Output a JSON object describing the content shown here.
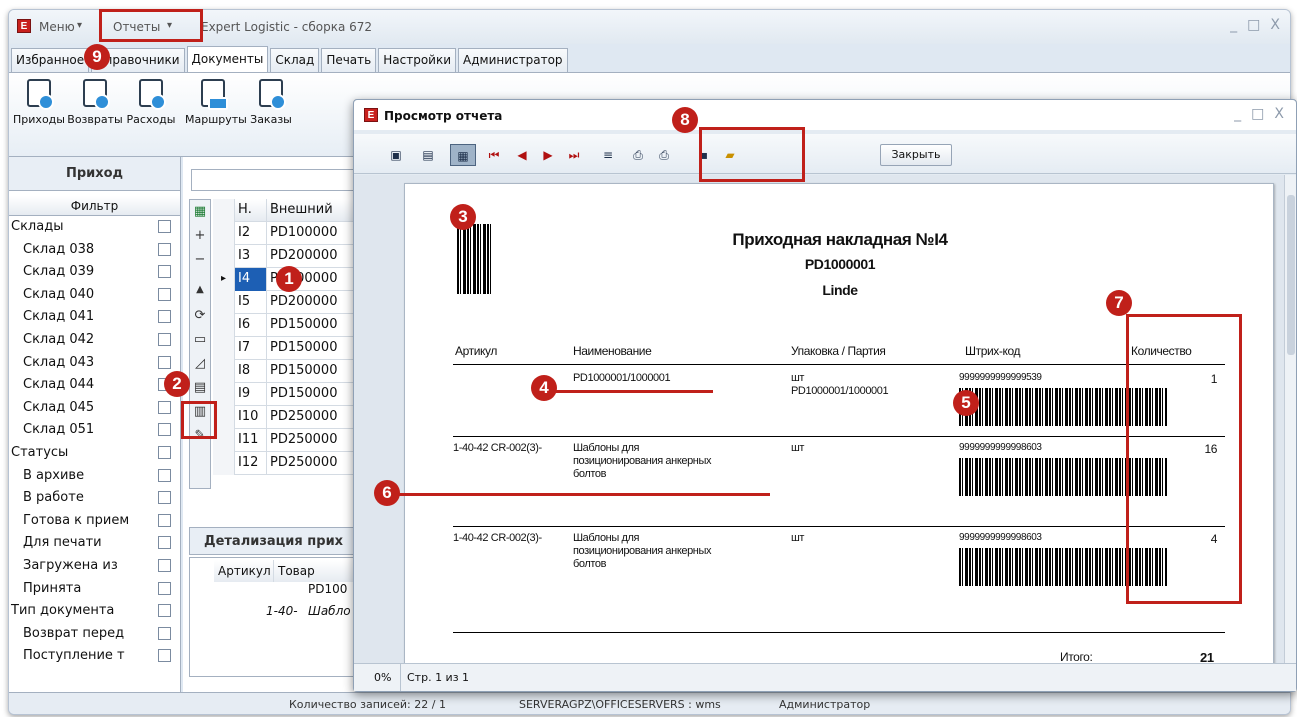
{
  "app": {
    "menu_label": "Меню",
    "reports_menu_label": "Отчеты",
    "title": "Expert Logistic - сборка 672",
    "logo_letter": "E",
    "minimize": "_",
    "maximize": "□",
    "close": "X"
  },
  "tabs": [
    "Избранное",
    "Справочники",
    "Документы",
    "Склад",
    "Печать",
    "Настройки",
    "Администратор"
  ],
  "ribbon": {
    "buttons": [
      "Приходы",
      "Возвраты",
      "Расходы",
      "Маршруты",
      "Заказы"
    ]
  },
  "left_panel": {
    "title": "Приход",
    "filter_title": "Фильтр",
    "items": [
      {
        "label": "Склады",
        "indent": false
      },
      {
        "label": "Склад 038",
        "indent": true
      },
      {
        "label": "Склад 039",
        "indent": true
      },
      {
        "label": "Склад 040",
        "indent": true
      },
      {
        "label": "Склад 041",
        "indent": true
      },
      {
        "label": "Склад 042",
        "indent": true
      },
      {
        "label": "Склад 043",
        "indent": true
      },
      {
        "label": "Склад 044",
        "indent": true
      },
      {
        "label": "Склад 045",
        "indent": true
      },
      {
        "label": "Склад 051",
        "indent": true
      },
      {
        "label": "Статусы",
        "indent": false
      },
      {
        "label": "В архиве",
        "indent": true
      },
      {
        "label": "В работе",
        "indent": true
      },
      {
        "label": "Готова к прием",
        "indent": true
      },
      {
        "label": "Для печати",
        "indent": true
      },
      {
        "label": "Загружена из",
        "indent": true
      },
      {
        "label": "Принята",
        "indent": true
      },
      {
        "label": "Тип документа",
        "indent": false
      },
      {
        "label": "Возврат перед",
        "indent": true
      },
      {
        "label": "Поступление т",
        "indent": true
      }
    ]
  },
  "grid": {
    "headers": [
      "Н.",
      "Внешний"
    ],
    "rows": [
      {
        "n": "I2",
        "ext": "PD100000"
      },
      {
        "n": "I3",
        "ext": "PD200000"
      },
      {
        "n": "I4",
        "ext": "PD100000"
      },
      {
        "n": "I5",
        "ext": "PD200000"
      },
      {
        "n": "I6",
        "ext": "PD150000"
      },
      {
        "n": "I7",
        "ext": "PD150000"
      },
      {
        "n": "I8",
        "ext": "PD150000"
      },
      {
        "n": "I9",
        "ext": "PD150000"
      },
      {
        "n": "I10",
        "ext": "PD250000"
      },
      {
        "n": "I11",
        "ext": "PD250000"
      },
      {
        "n": "I12",
        "ext": "PD250000"
      }
    ]
  },
  "detail": {
    "title": "Детализация прих",
    "headers": [
      "Артикул",
      "Товар"
    ],
    "row1": "PD100",
    "row2_art": "1-40-",
    "row2_name": "Шабло"
  },
  "statusbar": {
    "records": "Количество записей: 22 / 1",
    "server": "SERVERAGPZ\\OFFICESERVERS : wms",
    "user": "Администратор"
  },
  "report": {
    "window_title": "Просмотр отчета",
    "close_button": "Закрыть",
    "zoom": "0%",
    "page_info": "Стр. 1 из 1",
    "doc_title": "Приходная накладная №I4",
    "doc_number": "PD1000001",
    "supplier": "Linde",
    "columns": [
      "Артикул",
      "Наименование",
      "Упаковка / Партия",
      "Штрих-код",
      "Количество"
    ],
    "rows": [
      {
        "article": "",
        "name": [
          "PD1000001/1000001"
        ],
        "pack": [
          "шт",
          "PD1000001/1000001"
        ],
        "barcode": "9999999999999539",
        "qty": "1"
      },
      {
        "article": "1-40-42 CR-002(3)-",
        "name": [
          "Шаблоны для",
          "позиционирования анкерных",
          "болтов"
        ],
        "pack": [
          "шт"
        ],
        "barcode": "9999999999998603",
        "qty": "16"
      },
      {
        "article": "1-40-42 CR-002(3)-",
        "name": [
          "Шаблоны для",
          "позиционирования анкерных",
          "болтов"
        ],
        "pack": [
          "шт"
        ],
        "barcode": "9999999999998603",
        "qty": "4"
      }
    ],
    "total_label": "Итого:",
    "total_value": "21"
  },
  "badges": [
    "1",
    "2",
    "3",
    "4",
    "5",
    "6",
    "7",
    "8",
    "9"
  ],
  "colors": {
    "annotation_red": "#c0201a",
    "selection_blue": "#1d5fb4"
  }
}
